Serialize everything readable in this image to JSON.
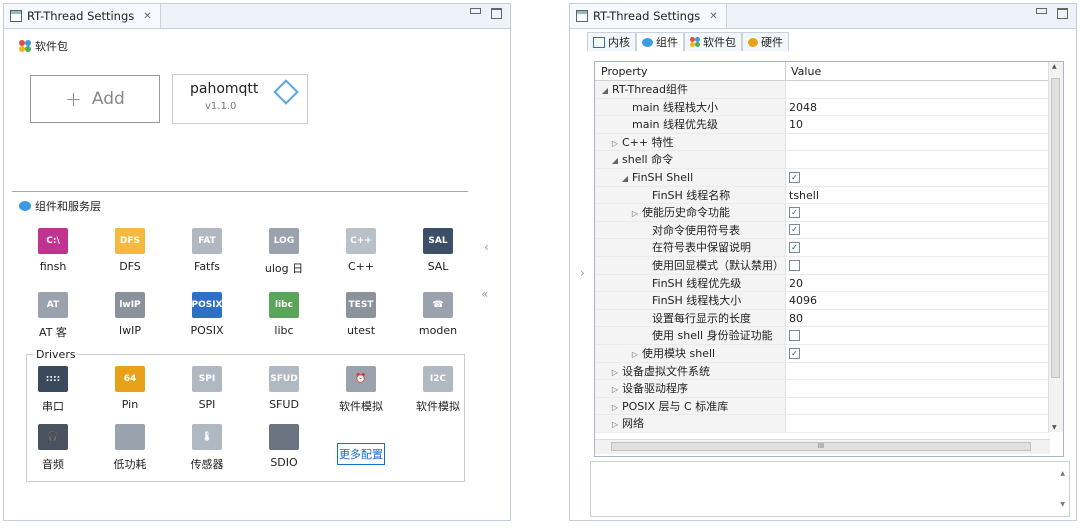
{
  "left": {
    "tab_title": "RT-Thread Settings",
    "close": "✕",
    "packages_title": "软件包",
    "add_label": "Add",
    "add_plus": "+",
    "package": {
      "name": "pahomqtt",
      "version": "v1.1.0"
    },
    "components_title": "组件和服务层",
    "components": [
      {
        "label": "finsh",
        "icon": "C:\\",
        "color": "#c0338f"
      },
      {
        "label": "DFS",
        "icon": "DFS",
        "color": "#f5b940"
      },
      {
        "label": "Fatfs",
        "icon": "FAT",
        "color": "#b0b8c2"
      },
      {
        "label": "ulog 日",
        "icon": "LOG",
        "color": "#9aa3ad"
      },
      {
        "label": "C++",
        "icon": "C++",
        "color": "#b8c0c8"
      },
      {
        "label": "SAL",
        "icon": "SAL",
        "color": "#3b4f66"
      },
      {
        "label": "AT 客",
        "icon": "AT",
        "color": "#9aa3ad"
      },
      {
        "label": "lwIP",
        "icon": "lwIP",
        "color": "#8a939c"
      },
      {
        "label": "POSIX",
        "icon": "POSIX",
        "color": "#2f6fc6"
      },
      {
        "label": "libc",
        "icon": "libc",
        "color": "#5aa55a"
      },
      {
        "label": "utest",
        "icon": "TEST",
        "color": "#8a939c"
      },
      {
        "label": "moden",
        "icon": "☎",
        "color": "#9aa3ad"
      }
    ],
    "drivers_title": "Drivers",
    "drivers": [
      {
        "label": "串口",
        "icon": "::::",
        "color": "#3a4a5c"
      },
      {
        "label": "Pin",
        "icon": "64",
        "color": "#e8a21a"
      },
      {
        "label": "SPI",
        "icon": "SPI",
        "color": "#b0b8c2"
      },
      {
        "label": "SFUD",
        "icon": "SFUD",
        "color": "#b0b8c2"
      },
      {
        "label": "软件模拟",
        "icon": "⏰",
        "color": "#9aa3ad"
      },
      {
        "label": "软件模拟",
        "icon": "I2C",
        "color": "#b0b8c2"
      },
      {
        "label": "音频",
        "icon": "🎧",
        "color": "#4a5260"
      },
      {
        "label": "低功耗",
        "icon": "",
        "color": "#9aa3ad"
      },
      {
        "label": "传感器",
        "icon": "🌡",
        "color": "#b0b8c2"
      },
      {
        "label": "SDIO",
        "icon": "",
        "color": "#6b7480"
      }
    ],
    "more_config": "更多配置",
    "scroll_left": "‹",
    "scroll_collapse": "«"
  },
  "right": {
    "tab_title": "RT-Thread Settings",
    "close": "✕",
    "subtabs": [
      "内核",
      "组件",
      "软件包",
      "硬件"
    ],
    "columns": [
      "Property",
      "Value"
    ],
    "rows": [
      {
        "p": "RT-Thread组件",
        "v": "",
        "indent": 0,
        "tw": "◢"
      },
      {
        "p": "main 线程栈大小",
        "v": "2048",
        "indent": 2,
        "tw": ""
      },
      {
        "p": "main 线程优先级",
        "v": "10",
        "indent": 2,
        "tw": ""
      },
      {
        "p": "C++ 特性",
        "v": "",
        "indent": 1,
        "tw": "▷"
      },
      {
        "p": "shell 命令",
        "v": "",
        "indent": 1,
        "tw": "◢"
      },
      {
        "p": "FinSH Shell",
        "v": "",
        "indent": 2,
        "tw": "◢",
        "check": "on"
      },
      {
        "p": "FinSH 线程名称",
        "v": "tshell",
        "indent": 4,
        "tw": ""
      },
      {
        "p": "使能历史命令功能",
        "v": "",
        "indent": 3,
        "tw": "▷",
        "check": "on"
      },
      {
        "p": "对命令使用符号表",
        "v": "",
        "indent": 4,
        "tw": "",
        "check": "on"
      },
      {
        "p": "在符号表中保留说明",
        "v": "",
        "indent": 4,
        "tw": "",
        "check": "on"
      },
      {
        "p": "使用回显模式（默认禁用）",
        "v": "",
        "indent": 4,
        "tw": "",
        "check": "off"
      },
      {
        "p": "FinSH 线程优先级",
        "v": "20",
        "indent": 4,
        "tw": ""
      },
      {
        "p": "FinSH 线程栈大小",
        "v": "4096",
        "indent": 4,
        "tw": ""
      },
      {
        "p": "设置每行显示的长度",
        "v": "80",
        "indent": 4,
        "tw": ""
      },
      {
        "p": "使用 shell 身份验证功能",
        "v": "",
        "indent": 4,
        "tw": "",
        "check": "off"
      },
      {
        "p": "使用模块 shell",
        "v": "",
        "indent": 3,
        "tw": "▷",
        "check": "on"
      },
      {
        "p": "设备虚拟文件系统",
        "v": "",
        "indent": 1,
        "tw": "▷"
      },
      {
        "p": "设备驱动程序",
        "v": "",
        "indent": 1,
        "tw": "▷"
      },
      {
        "p": "POSIX 层与 C 标准库",
        "v": "",
        "indent": 1,
        "tw": "▷"
      },
      {
        "p": "网络",
        "v": "",
        "indent": 1,
        "tw": "▷"
      }
    ],
    "hscroll_mark": "III",
    "side_arrow": "›",
    "up_arrow": "▲",
    "down_arrow": "▼"
  }
}
